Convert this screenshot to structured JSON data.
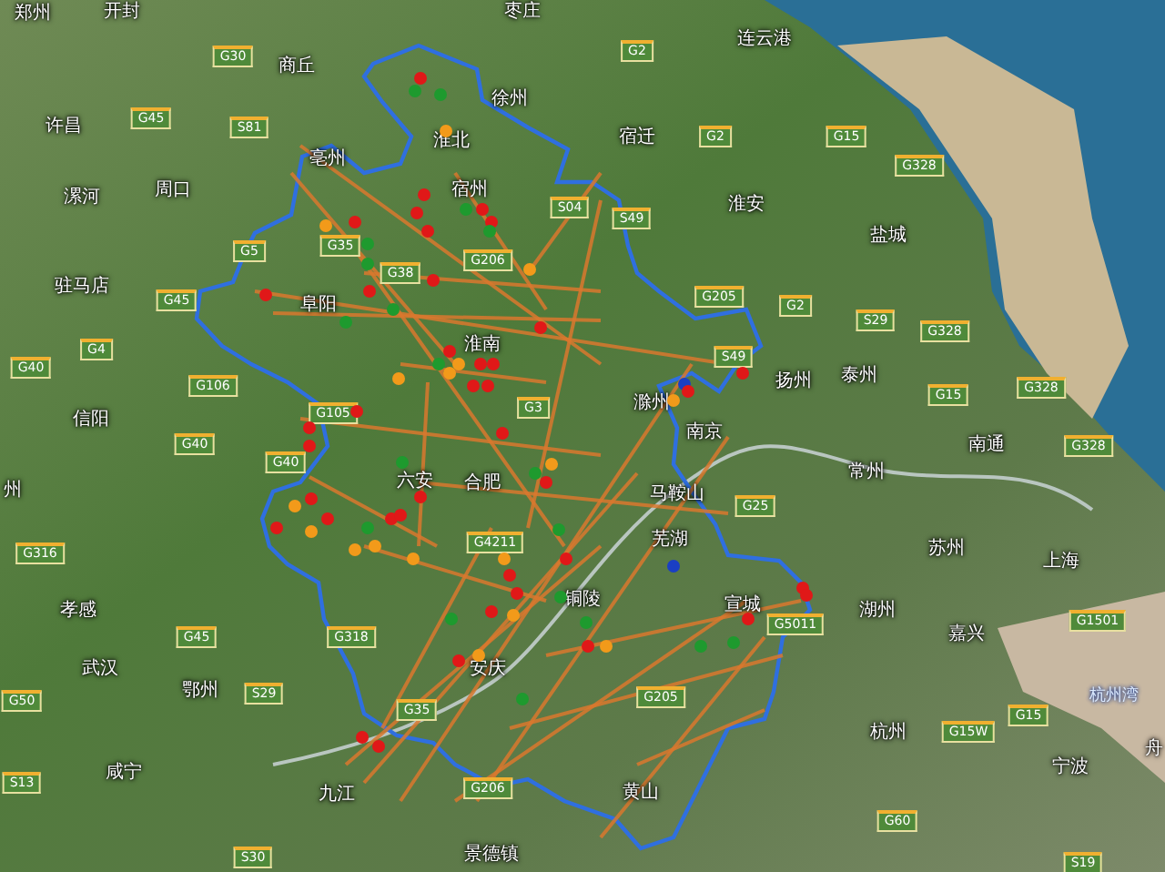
{
  "map": {
    "cities": [
      {
        "name": "郑州",
        "kind": "city"
      },
      {
        "name": "开封",
        "kind": "city"
      },
      {
        "name": "枣庄",
        "kind": "city"
      },
      {
        "name": "商丘",
        "kind": "city"
      },
      {
        "name": "徐州",
        "kind": "city"
      },
      {
        "name": "连云港",
        "kind": "city"
      },
      {
        "name": "许昌",
        "kind": "city"
      },
      {
        "name": "淮北",
        "kind": "city"
      },
      {
        "name": "亳州",
        "kind": "city"
      },
      {
        "name": "宿迁",
        "kind": "city"
      },
      {
        "name": "漯河",
        "kind": "city"
      },
      {
        "name": "周口",
        "kind": "city"
      },
      {
        "name": "宿州",
        "kind": "city"
      },
      {
        "name": "淮安",
        "kind": "city"
      },
      {
        "name": "盐城",
        "kind": "city"
      },
      {
        "name": "驻马店",
        "kind": "city"
      },
      {
        "name": "阜阳",
        "kind": "city"
      },
      {
        "name": "淮南",
        "kind": "city"
      },
      {
        "name": "滁州",
        "kind": "city"
      },
      {
        "name": "扬州",
        "kind": "city"
      },
      {
        "name": "泰州",
        "kind": "city"
      },
      {
        "name": "信阳",
        "kind": "city"
      },
      {
        "name": "南京",
        "kind": "city"
      },
      {
        "name": "南通",
        "kind": "city"
      },
      {
        "name": "常州",
        "kind": "city"
      },
      {
        "name": "州",
        "kind": "city"
      },
      {
        "name": "六安",
        "kind": "city"
      },
      {
        "name": "合肥",
        "kind": "city"
      },
      {
        "name": "马鞍山",
        "kind": "city"
      },
      {
        "name": "芜湖",
        "kind": "city"
      },
      {
        "name": "苏州",
        "kind": "city"
      },
      {
        "name": "上海",
        "kind": "city"
      },
      {
        "name": "孝感",
        "kind": "city"
      },
      {
        "name": "铜陵",
        "kind": "city"
      },
      {
        "name": "宣城",
        "kind": "city"
      },
      {
        "name": "湖州",
        "kind": "city"
      },
      {
        "name": "嘉兴",
        "kind": "city"
      },
      {
        "name": "武汉",
        "kind": "city"
      },
      {
        "name": "鄂州",
        "kind": "city"
      },
      {
        "name": "安庆",
        "kind": "city"
      },
      {
        "name": "杭州湾",
        "kind": "water"
      },
      {
        "name": "杭州",
        "kind": "city"
      },
      {
        "name": "舟",
        "kind": "city"
      },
      {
        "name": "宁波",
        "kind": "city"
      },
      {
        "name": "咸宁",
        "kind": "city"
      },
      {
        "name": "九江",
        "kind": "city"
      },
      {
        "name": "黄山",
        "kind": "city"
      },
      {
        "name": "景德镇",
        "kind": "city"
      }
    ],
    "highway_shields": [
      {
        "label": "G30"
      },
      {
        "label": "G2"
      },
      {
        "label": "S81"
      },
      {
        "label": "G45"
      },
      {
        "label": "G2"
      },
      {
        "label": "G15"
      },
      {
        "label": "G328"
      },
      {
        "label": "S04"
      },
      {
        "label": "G35"
      },
      {
        "label": "G5"
      },
      {
        "label": "G38"
      },
      {
        "label": "G206"
      },
      {
        "label": "S49"
      },
      {
        "label": "G205"
      },
      {
        "label": "G2"
      },
      {
        "label": "S29"
      },
      {
        "label": "G328"
      },
      {
        "label": "G45"
      },
      {
        "label": "G4"
      },
      {
        "label": "G40"
      },
      {
        "label": "G106"
      },
      {
        "label": "G3"
      },
      {
        "label": "G105"
      },
      {
        "label": "S49"
      },
      {
        "label": "G15"
      },
      {
        "label": "G328"
      },
      {
        "label": "G40"
      },
      {
        "label": "G40"
      },
      {
        "label": "G328"
      },
      {
        "label": "G25"
      },
      {
        "label": "G4211"
      },
      {
        "label": "G316"
      },
      {
        "label": "G45"
      },
      {
        "label": "G318"
      },
      {
        "label": "G5011"
      },
      {
        "label": "G1501"
      },
      {
        "label": "S29"
      },
      {
        "label": "G35"
      },
      {
        "label": "G205"
      },
      {
        "label": "G206"
      },
      {
        "label": "G15W"
      },
      {
        "label": "G15"
      },
      {
        "label": "G50"
      },
      {
        "label": "S13"
      },
      {
        "label": "S30"
      },
      {
        "label": "G60"
      },
      {
        "label": "S19"
      }
    ],
    "markers": [
      {
        "color": "#e01818"
      },
      {
        "color": "#1e9a2e"
      },
      {
        "color": "#1e9a2e"
      },
      {
        "color": "#f29a1a"
      },
      {
        "color": "#e01818"
      },
      {
        "color": "#e01818"
      },
      {
        "color": "#e01818"
      },
      {
        "color": "#1e9a2e"
      },
      {
        "color": "#e01818"
      },
      {
        "color": "#e01818"
      },
      {
        "color": "#1e9a2e"
      },
      {
        "color": "#f29a1a"
      },
      {
        "color": "#e01818"
      },
      {
        "color": "#1e9a2e"
      },
      {
        "color": "#1e9a2e"
      },
      {
        "color": "#e01818"
      },
      {
        "color": "#f29a1a"
      },
      {
        "color": "#e01818"
      },
      {
        "color": "#e01818"
      },
      {
        "color": "#1e9a2e"
      },
      {
        "color": "#1e9a2e"
      },
      {
        "color": "#e01818"
      },
      {
        "color": "#e01818"
      },
      {
        "color": "#f29a1a"
      },
      {
        "color": "#f29a1a"
      },
      {
        "color": "#e01818"
      },
      {
        "color": "#e01818"
      },
      {
        "color": "#1e9a2e"
      },
      {
        "color": "#e01818"
      },
      {
        "color": "#e01818"
      },
      {
        "color": "#f29a1a"
      },
      {
        "color": "#e01818"
      },
      {
        "color": "#e01818"
      },
      {
        "color": "#e01818"
      },
      {
        "color": "#e01818"
      },
      {
        "color": "#1e9a2e"
      },
      {
        "color": "#f29a1a"
      },
      {
        "color": "#1e9a2e"
      },
      {
        "color": "#e01818"
      },
      {
        "color": "#e01818"
      },
      {
        "color": "#f29a1a"
      },
      {
        "color": "#e01818"
      },
      {
        "color": "#e01818"
      },
      {
        "color": "#f29a1a"
      },
      {
        "color": "#e01818"
      },
      {
        "color": "#1e9a2e"
      },
      {
        "color": "#e01818"
      },
      {
        "color": "#e01818"
      },
      {
        "color": "#f29a1a"
      },
      {
        "color": "#f29a1a"
      },
      {
        "color": "#f29a1a"
      },
      {
        "color": "#e01818"
      },
      {
        "color": "#1e9a2e"
      },
      {
        "color": "#f29a1a"
      },
      {
        "color": "#e01818"
      },
      {
        "color": "#e01818"
      },
      {
        "color": "#1e9a2e"
      },
      {
        "color": "#f29a1a"
      },
      {
        "color": "#e01818"
      },
      {
        "color": "#1e9a2e"
      },
      {
        "color": "#e01818"
      },
      {
        "color": "#f29a1a"
      },
      {
        "color": "#1e9a2e"
      },
      {
        "color": "#e01818"
      },
      {
        "color": "#e01818"
      },
      {
        "color": "#1a3fc4"
      },
      {
        "color": "#e01818"
      },
      {
        "color": "#e01818"
      },
      {
        "color": "#e01818"
      },
      {
        "color": "#1e9a2e"
      },
      {
        "color": "#1e9a2e"
      },
      {
        "color": "#f29a1a"
      },
      {
        "color": "#e01818"
      },
      {
        "color": "#1e9a2e"
      },
      {
        "color": "#1a3fc4"
      },
      {
        "color": "#e01818"
      },
      {
        "color": "#e01818"
      },
      {
        "color": "#f29a1a"
      }
    ]
  }
}
